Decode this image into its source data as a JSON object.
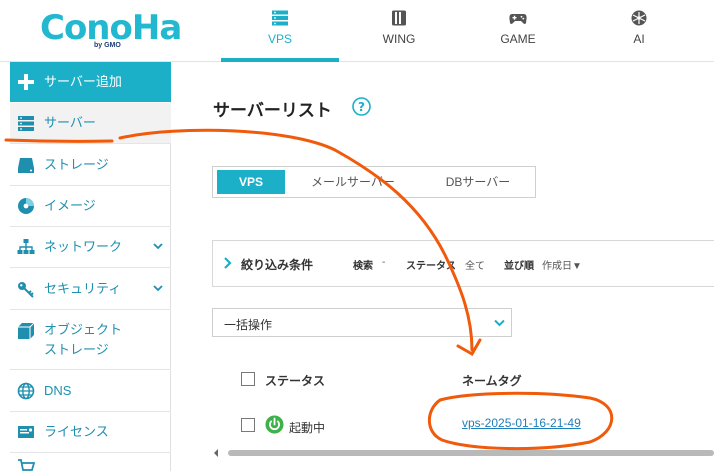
{
  "brand": {
    "logo_text": "ConoHa",
    "logo_sub": "by GMO"
  },
  "top_nav": [
    {
      "label": "VPS",
      "icon": "server-stack-icon",
      "active": true
    },
    {
      "label": "WING",
      "icon": "book-icon",
      "active": false
    },
    {
      "label": "GAME",
      "icon": "gamepad-icon",
      "active": false
    },
    {
      "label": "AI",
      "icon": "ai-network-icon",
      "active": false
    }
  ],
  "sidebar": {
    "items": [
      {
        "label": "サーバー追加",
        "icon": "plus-icon"
      },
      {
        "label": "サーバー",
        "icon": "server-icon"
      },
      {
        "label": "ストレージ",
        "icon": "disk-icon"
      },
      {
        "label": "イメージ",
        "icon": "image-disc-icon"
      },
      {
        "label": "ネットワーク",
        "icon": "network-icon"
      },
      {
        "label": "セキュリティ",
        "icon": "key-icon"
      },
      {
        "label_line1": "オブジェクト",
        "label_line2": "ストレージ",
        "icon": "cube-icon"
      },
      {
        "label": "DNS",
        "icon": "globe-icon"
      },
      {
        "label": "ライセンス",
        "icon": "license-card-icon"
      }
    ]
  },
  "main": {
    "page_title": "サーバーリスト",
    "type_tabs": [
      {
        "label": "VPS",
        "active": true
      },
      {
        "label": "メールサーバー",
        "active": false
      },
      {
        "label": "DBサーバー",
        "active": false
      }
    ],
    "filter": {
      "title": "絞り込み条件",
      "search_key": "検索",
      "search_value": "-",
      "status_key": "ステータス",
      "status_value": "全て",
      "sort_key": "並び順",
      "sort_value": "作成日▼"
    },
    "bulk_action": {
      "selected": "一括操作"
    },
    "table": {
      "columns": [
        "ステータス",
        "ネームタグ"
      ],
      "rows": [
        {
          "status": "起動中",
          "name_tag": "vps-2025-01-16-21-49"
        }
      ]
    }
  },
  "colors": {
    "accent": "#1cb0c8",
    "link": "#1f7fb8",
    "status_on": "#3db14a",
    "annotation": "#f05a0a"
  }
}
